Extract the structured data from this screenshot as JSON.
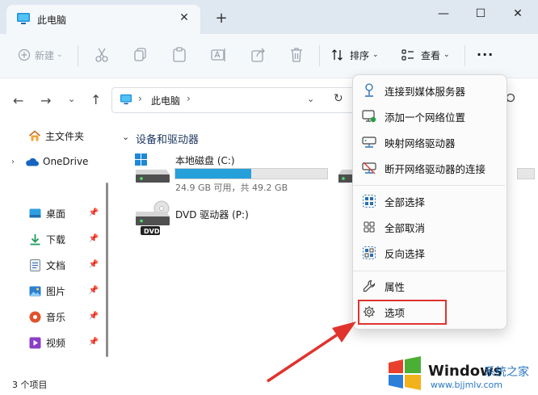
{
  "window": {
    "tab_title": "此电脑",
    "tab_close": "✕",
    "new_tab": "+",
    "minimize": "—",
    "maximize": "☐",
    "close": "✕"
  },
  "toolbar": {
    "new_label": "新建",
    "sort_label": "排序",
    "view_label": "查看",
    "more_label": "···"
  },
  "address": {
    "segment": "此电脑",
    "chevron": "›"
  },
  "sidebar": {
    "items": [
      {
        "label": "主文件夹",
        "icon": "home-icon"
      },
      {
        "label": "OneDrive",
        "icon": "cloud-icon"
      },
      {
        "label": "桌面",
        "icon": "desktop-icon",
        "pinned": true
      },
      {
        "label": "下载",
        "icon": "download-icon",
        "pinned": true
      },
      {
        "label": "文档",
        "icon": "document-icon",
        "pinned": true
      },
      {
        "label": "图片",
        "icon": "picture-icon",
        "pinned": true
      },
      {
        "label": "音乐",
        "icon": "music-icon",
        "pinned": true
      },
      {
        "label": "视频",
        "icon": "video-icon",
        "pinned": true
      }
    ]
  },
  "main": {
    "group_title": "设备和驱动器",
    "drives": [
      {
        "name": "本地磁盘 (C:)",
        "info": "24.9 GB 可用，共 49.2 GB",
        "used_fraction": 0.494
      },
      {
        "name": "DVD 驱动器 (P:)",
        "badge": "DVD"
      }
    ]
  },
  "menu": {
    "items": [
      {
        "label": "连接到媒体服务器",
        "icon": "media-server-icon"
      },
      {
        "label": "添加一个网络位置",
        "icon": "network-location-icon"
      },
      {
        "label": "映射网络驱动器",
        "icon": "map-drive-icon"
      },
      {
        "label": "断开网络驱动器的连接",
        "icon": "disconnect-drive-icon"
      },
      {
        "label": "全部选择",
        "icon": "select-all-icon"
      },
      {
        "label": "全部取消",
        "icon": "select-none-icon"
      },
      {
        "label": "反向选择",
        "icon": "invert-selection-icon"
      },
      {
        "label": "属性",
        "icon": "properties-icon"
      },
      {
        "label": "选项",
        "icon": "options-icon"
      }
    ]
  },
  "status": {
    "count": "3 个项目"
  },
  "watermark": {
    "brand": "Windows",
    "cn": "系统之家",
    "url": "www.bjjmlv.com"
  },
  "colors": {
    "accent": "#26a0da",
    "highlight": "#e0332e",
    "arrow": "#e0332e",
    "window_bg": "#f5f8fb"
  }
}
